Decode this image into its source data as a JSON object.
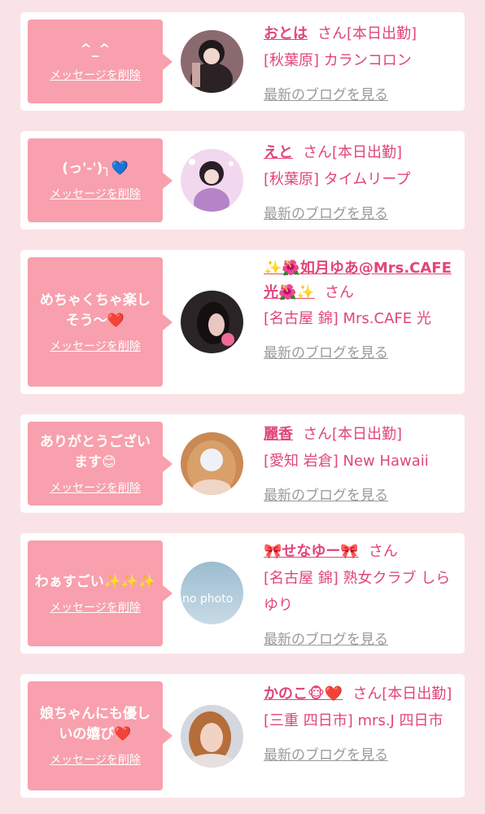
{
  "cards": [
    {
      "message": "^_^",
      "delete_label": "メッセージを削除",
      "name": "おとは",
      "suffix": "さん[本日出勤]",
      "shop": "[秋葉原] カランコロン",
      "blog_label": "最新のブログを見る"
    },
    {
      "message": "(っ'-')╮💙",
      "delete_label": "メッセージを削除",
      "name": "えと",
      "suffix": "さん[本日出勤]",
      "shop": "[秋葉原] タイムリープ",
      "blog_label": "最新のブログを見る"
    },
    {
      "message": "めちゃくちゃ楽しそう〜❤️",
      "delete_label": "メッセージを削除",
      "name": "✨🌺如月ゆあ@Mrs.CAFE光🌺✨",
      "suffix": "さん",
      "shop": "[名古屋 錦] Mrs.CAFE 光",
      "blog_label": "最新のブログを見る"
    },
    {
      "message": "ありがとうございます😊",
      "delete_label": "メッセージを削除",
      "name": "麗香",
      "suffix": "さん[本日出勤]",
      "shop": "[愛知 岩倉] New Hawaii",
      "blog_label": "最新のブログを見る"
    },
    {
      "message": "わぁすごい✨✨✨",
      "delete_label": "メッセージを削除",
      "name": "🎀せなゆー🎀",
      "suffix": "さん",
      "shop": "[名古屋 錦] 熟女クラブ しらゆり",
      "blog_label": "最新のブログを見る",
      "avatar_text": "no photo"
    },
    {
      "message": "娘ちゃんにも優しいの嬉び❤️",
      "delete_label": "メッセージを削除",
      "name": "かのこ🐵❤️",
      "suffix": "さん[本日出勤]",
      "shop": "[三重 四日市] mrs.J 四日市",
      "blog_label": "最新のブログを見る"
    }
  ],
  "colors": {
    "background": "#fae3e7",
    "bubble": "#f8a0ad",
    "accent": "#e0457b",
    "link_gray": "#9a9a9a"
  }
}
